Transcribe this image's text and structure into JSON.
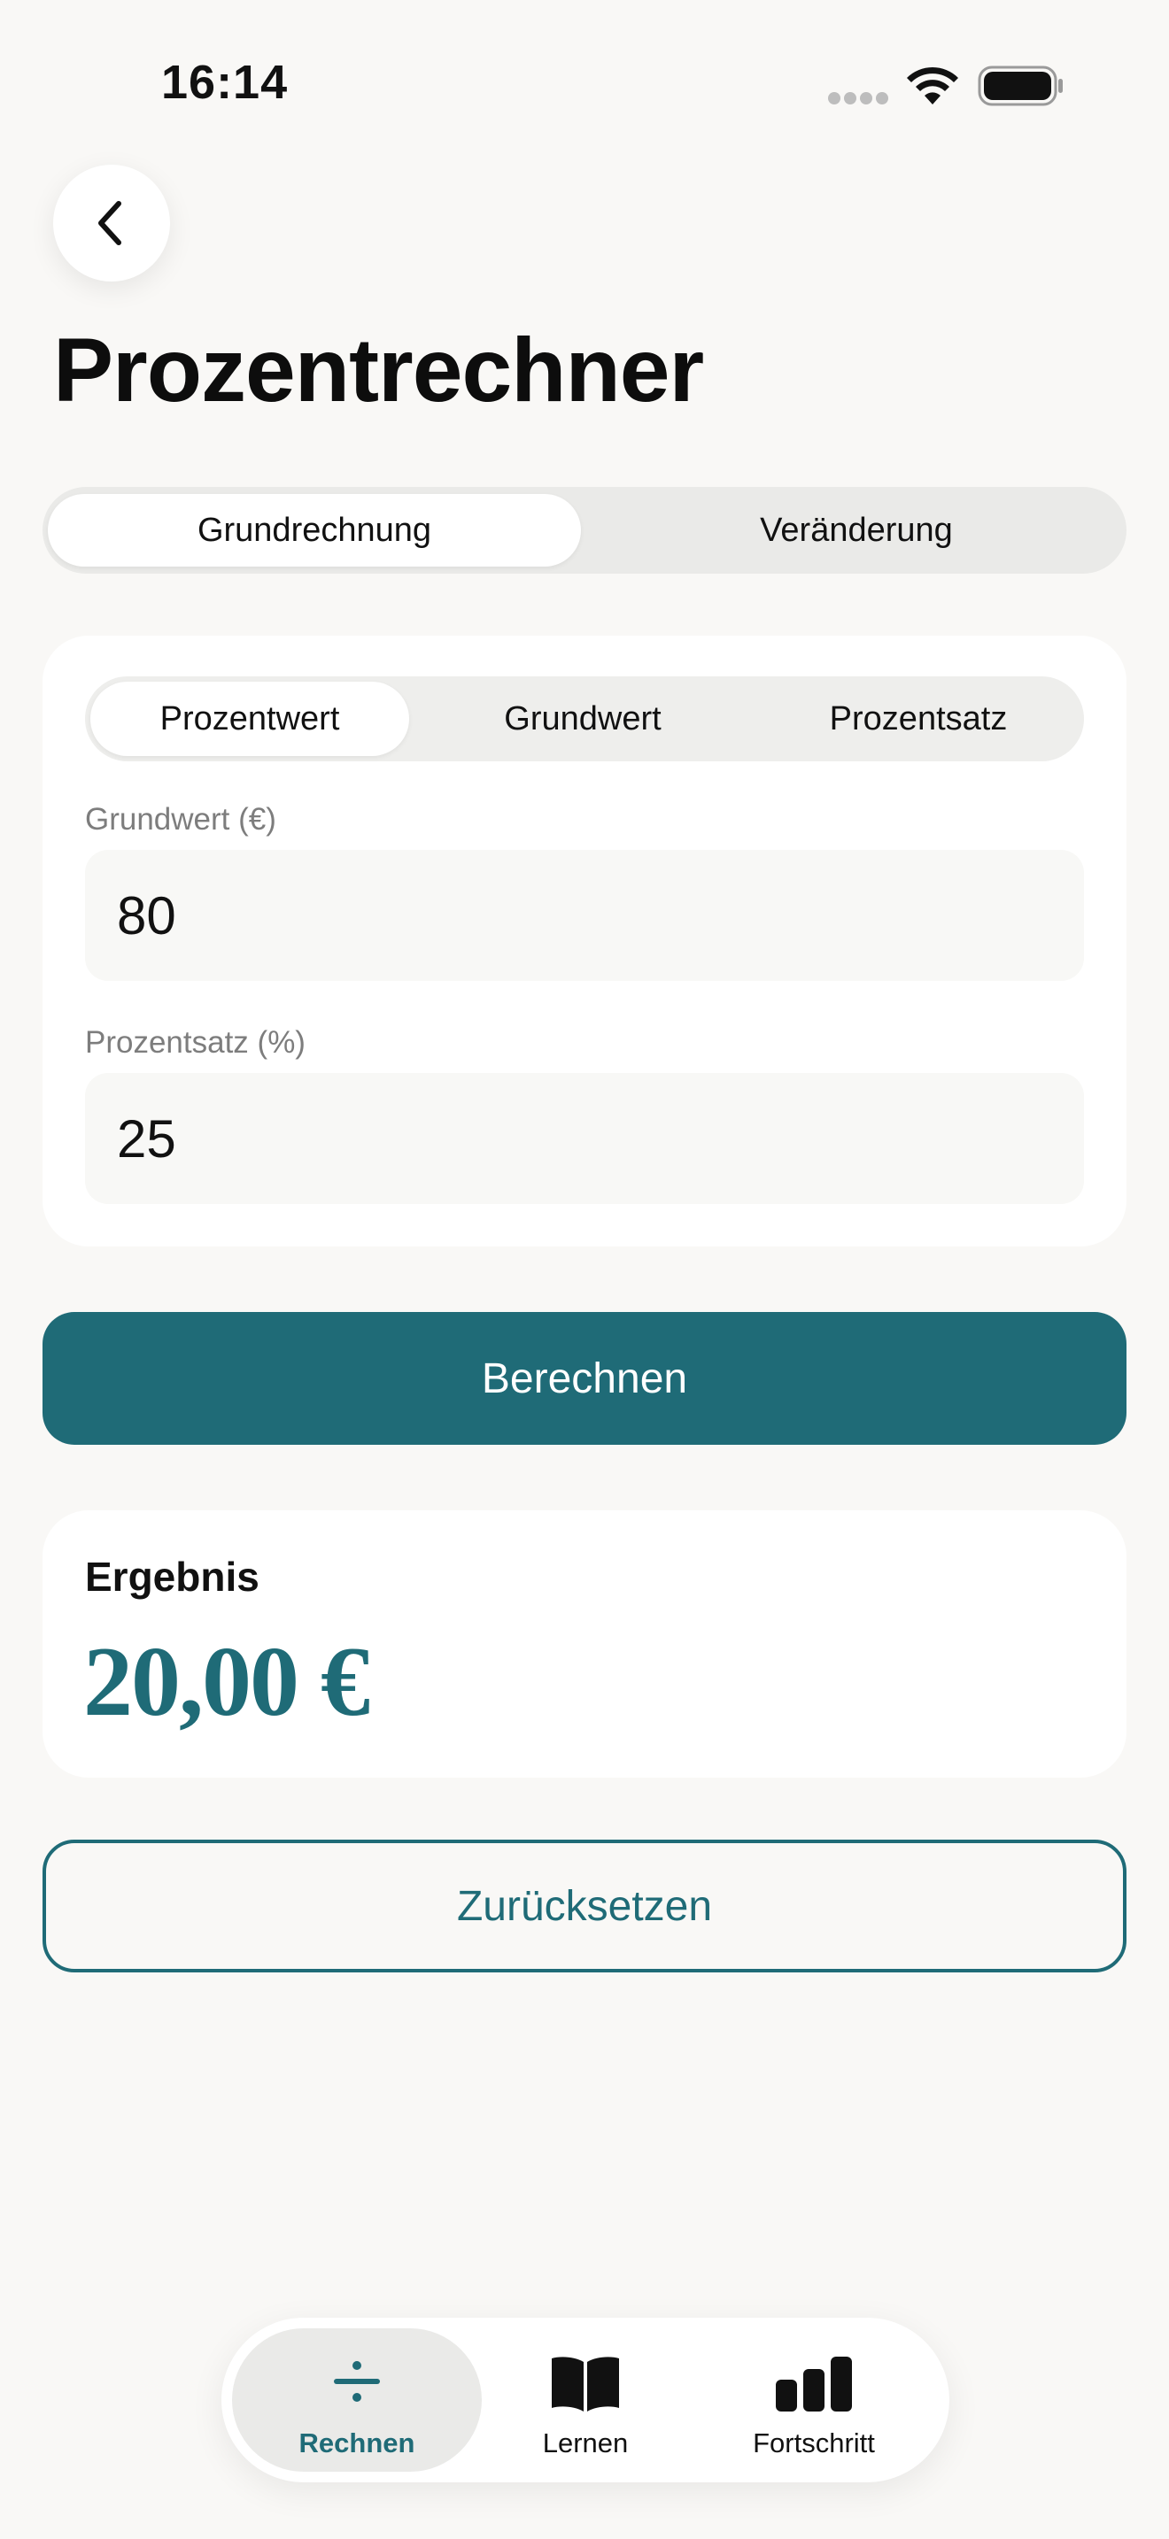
{
  "status_bar": {
    "time": "16:14"
  },
  "header": {
    "title": "Prozentrechner"
  },
  "mode_tabs": [
    {
      "label": "Grundrechnung",
      "active": true
    },
    {
      "label": "Veränderung",
      "active": false
    }
  ],
  "calc_type_tabs": [
    {
      "label": "Prozentwert",
      "active": true
    },
    {
      "label": "Grundwert",
      "active": false
    },
    {
      "label": "Prozentsatz",
      "active": false
    }
  ],
  "fields": {
    "base_value": {
      "label": "Grundwert (€)",
      "value": "80"
    },
    "percent_rate": {
      "label": "Prozentsatz (%)",
      "value": "25"
    }
  },
  "actions": {
    "calculate_label": "Berechnen",
    "reset_label": "Zurücksetzen"
  },
  "result": {
    "label": "Ergebnis",
    "value": "20,00 €"
  },
  "tab_bar": [
    {
      "label": "Rechnen",
      "icon": "divide-icon",
      "active": true
    },
    {
      "label": "Lernen",
      "icon": "book-icon",
      "active": false
    },
    {
      "label": "Fortschritt",
      "icon": "bar-chart-icon",
      "active": false
    }
  ],
  "colors": {
    "accent": "#1f6b77",
    "background": "#f9f8f6",
    "card": "#ffffff"
  }
}
